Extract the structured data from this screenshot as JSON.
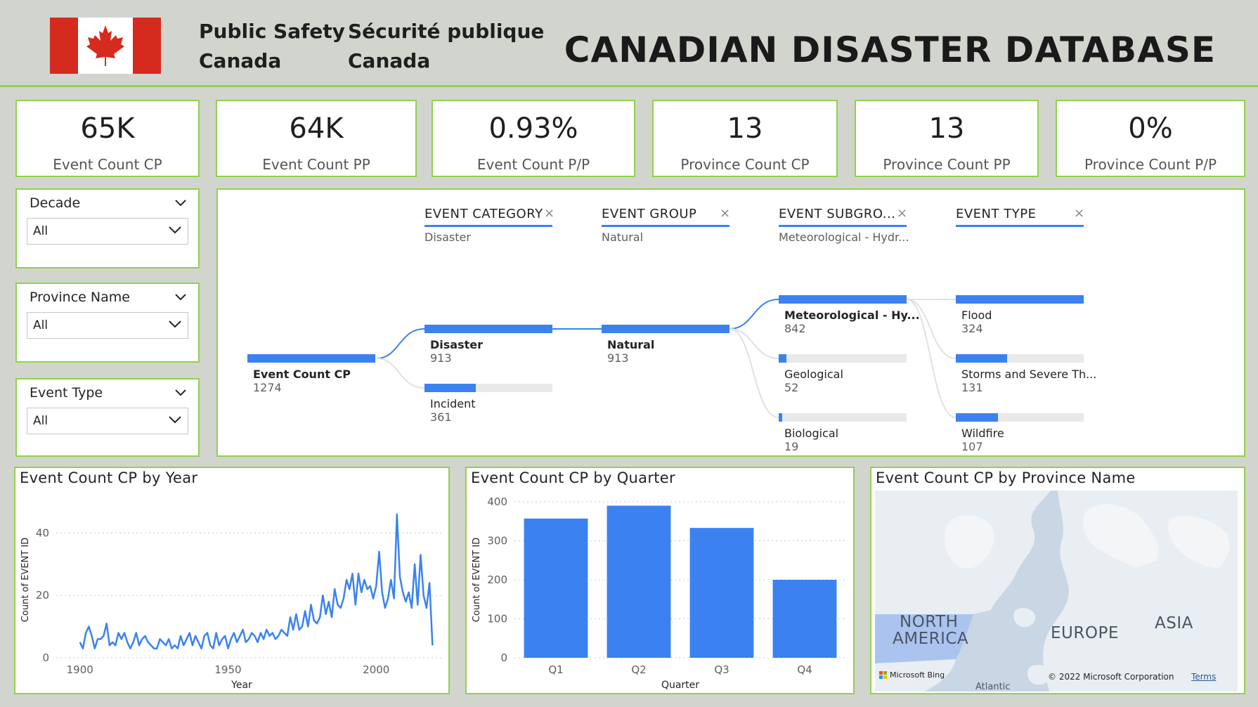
{
  "header": {
    "org_en_line1": "Public Safety",
    "org_en_line2": "Canada",
    "org_fr_line1": "Sécurité publique",
    "org_fr_line2": "Canada",
    "title": "CANADIAN DISASTER DATABASE",
    "flag_icon": "canada-flag-icon"
  },
  "kpis": [
    {
      "value": "65K",
      "label": "Event Count CP"
    },
    {
      "value": "64K",
      "label": "Event Count PP"
    },
    {
      "value": "0.93%",
      "label": "Event Count P/P"
    },
    {
      "value": "13",
      "label": "Province Count CP"
    },
    {
      "value": "13",
      "label": "Province Count PP"
    },
    {
      "value": "0%",
      "label": "Province Count P/P"
    }
  ],
  "slicers": [
    {
      "title": "Decade",
      "selected": "All"
    },
    {
      "title": "Province Name",
      "selected": "All"
    },
    {
      "title": "Event Type",
      "selected": "All"
    }
  ],
  "decomposition_tree": {
    "levels": [
      {
        "header": "EVENT CATEGORY",
        "selection": "Disaster"
      },
      {
        "header": "EVENT GROUP",
        "selection": "Natural"
      },
      {
        "header": "EVENT SUBGRO...",
        "selection": "Meteorological - Hydr..."
      },
      {
        "header": "EVENT TYPE",
        "selection": ""
      }
    ],
    "root": {
      "name": "Event Count CP",
      "value": "1274"
    },
    "category": [
      {
        "name": "Disaster",
        "value": "913",
        "fraction": 1.0
      },
      {
        "name": "Incident",
        "value": "361",
        "fraction": 0.4
      }
    ],
    "group": [
      {
        "name": "Natural",
        "value": "913",
        "fraction": 1.0
      }
    ],
    "subgroup": [
      {
        "name": "Meteorological - Hy...",
        "value": "842",
        "fraction": 1.0
      },
      {
        "name": "Geological",
        "value": "52",
        "fraction": 0.06
      },
      {
        "name": "Biological",
        "value": "19",
        "fraction": 0.025
      }
    ],
    "type": [
      {
        "name": "Flood",
        "value": "324",
        "fraction": 1.0
      },
      {
        "name": "Storms and Severe Th...",
        "value": "131",
        "fraction": 0.4
      },
      {
        "name": "Wildfire",
        "value": "107",
        "fraction": 0.33
      }
    ]
  },
  "line_chart": {
    "title": "Event Count CP by Year",
    "chart_data": {
      "type": "line",
      "xlabel": "Year",
      "ylabel": "Count of EVENT ID",
      "x_ticks": [
        "1900",
        "1950",
        "2000"
      ],
      "y_ticks": [
        "0",
        "20",
        "40"
      ],
      "xlim": [
        1892,
        2022
      ],
      "ylim": [
        0,
        50
      ],
      "color": "#3b82f0",
      "x": [
        1900,
        1901,
        1902,
        1903,
        1904,
        1905,
        1906,
        1907,
        1908,
        1909,
        1910,
        1911,
        1912,
        1913,
        1914,
        1915,
        1916,
        1917,
        1918,
        1919,
        1920,
        1921,
        1922,
        1923,
        1924,
        1925,
        1926,
        1927,
        1928,
        1929,
        1930,
        1931,
        1932,
        1933,
        1934,
        1935,
        1936,
        1937,
        1938,
        1939,
        1940,
        1941,
        1942,
        1943,
        1944,
        1945,
        1946,
        1947,
        1948,
        1949,
        1950,
        1951,
        1952,
        1953,
        1954,
        1955,
        1956,
        1957,
        1958,
        1959,
        1960,
        1961,
        1962,
        1963,
        1964,
        1965,
        1966,
        1967,
        1968,
        1969,
        1970,
        1971,
        1972,
        1973,
        1974,
        1975,
        1976,
        1977,
        1978,
        1979,
        1980,
        1981,
        1982,
        1983,
        1984,
        1985,
        1986,
        1987,
        1988,
        1989,
        1990,
        1991,
        1992,
        1993,
        1994,
        1995,
        1996,
        1997,
        1998,
        1999,
        2000,
        2001,
        2002,
        2003,
        2004,
        2005,
        2006,
        2007,
        2008,
        2009,
        2010,
        2011,
        2012,
        2013,
        2014,
        2015,
        2016,
        2017,
        2018,
        2019
      ],
      "y": [
        5,
        3,
        8,
        10,
        7,
        3,
        6,
        6,
        7,
        11,
        4,
        5,
        4,
        8,
        6,
        8,
        5,
        3,
        5,
        8,
        4,
        6,
        7,
        5,
        4,
        3,
        3,
        6,
        5,
        4,
        6,
        3,
        4,
        3,
        7,
        4,
        6,
        8,
        4,
        7,
        5,
        3,
        7,
        8,
        4,
        3,
        8,
        4,
        6,
        7,
        3,
        6,
        8,
        5,
        7,
        9,
        5,
        6,
        8,
        7,
        5,
        8,
        6,
        9,
        7,
        8,
        6,
        7,
        9,
        8,
        7,
        13,
        9,
        14,
        9,
        10,
        15,
        10,
        17,
        12,
        11,
        13,
        20,
        14,
        18,
        13,
        22,
        17,
        16,
        19,
        25,
        22,
        27,
        17,
        27,
        21,
        25,
        22,
        23,
        19,
        23,
        34,
        21,
        16,
        19,
        25,
        19,
        46,
        26,
        21,
        18,
        21,
        16,
        30,
        17,
        33,
        20,
        16,
        24,
        4
      ]
    }
  },
  "bar_chart": {
    "title": "Event Count CP by Quarter",
    "chart_data": {
      "type": "bar",
      "categories": [
        "Q1",
        "Q2",
        "Q3",
        "Q4"
      ],
      "values": [
        357,
        390,
        333,
        200
      ],
      "xlabel": "Quarter",
      "ylabel": "Count of EVENT ID",
      "y_ticks": [
        "0",
        "100",
        "200",
        "300",
        "400"
      ],
      "ylim": [
        0,
        400
      ],
      "color": "#3b82f0"
    }
  },
  "map": {
    "title": "Event Count CP by Province Name",
    "labels": {
      "north": "NORTH",
      "america": "AMERICA",
      "europe": "EUROPE",
      "asia": "ASIA",
      "atlantic": "Atlantic"
    },
    "attribution": "© 2022 Microsoft Corporation",
    "terms": "Terms",
    "bing": "Microsoft Bing"
  },
  "colors": {
    "accent": "#3b82f0",
    "border": "#92d050",
    "background": "#d2d5cd",
    "flag_red": "#d52b1e"
  }
}
